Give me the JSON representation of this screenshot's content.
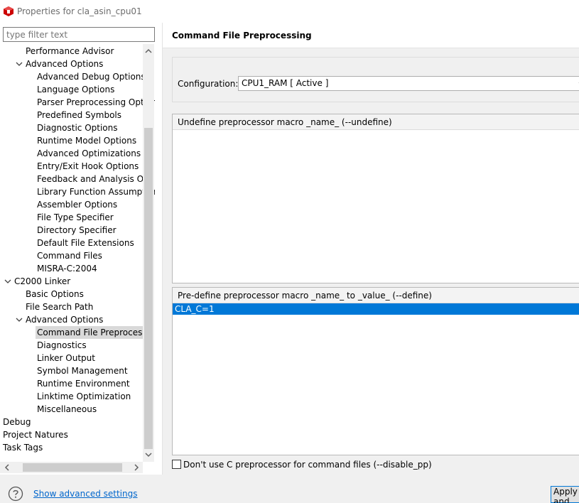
{
  "window": {
    "title": "Properties for cla_asin_cpu01",
    "icon": "ti-logo-icon",
    "accent": "#cc0000"
  },
  "filter": {
    "placeholder": "type filter text"
  },
  "tree": {
    "items": [
      {
        "label": "Performance Advisor",
        "depth": 2,
        "arrow": "none",
        "selected": false
      },
      {
        "label": "Advanced Options",
        "depth": 1,
        "arrow": "expanded",
        "selected": false
      },
      {
        "label": "Advanced Debug Options",
        "depth": 3,
        "arrow": "none",
        "selected": false
      },
      {
        "label": "Language Options",
        "depth": 3,
        "arrow": "none",
        "selected": false
      },
      {
        "label": "Parser Preprocessing Options",
        "depth": 3,
        "arrow": "none",
        "selected": false
      },
      {
        "label": "Predefined Symbols",
        "depth": 3,
        "arrow": "none",
        "selected": false
      },
      {
        "label": "Diagnostic Options",
        "depth": 3,
        "arrow": "none",
        "selected": false
      },
      {
        "label": "Runtime Model Options",
        "depth": 3,
        "arrow": "none",
        "selected": false
      },
      {
        "label": "Advanced Optimizations",
        "depth": 3,
        "arrow": "none",
        "selected": false
      },
      {
        "label": "Entry/Exit Hook Options",
        "depth": 3,
        "arrow": "none",
        "selected": false
      },
      {
        "label": "Feedback and Analysis Options",
        "depth": 3,
        "arrow": "none",
        "selected": false
      },
      {
        "label": "Library Function Assumptions",
        "depth": 3,
        "arrow": "none",
        "selected": false
      },
      {
        "label": "Assembler Options",
        "depth": 3,
        "arrow": "none",
        "selected": false
      },
      {
        "label": "File Type Specifier",
        "depth": 3,
        "arrow": "none",
        "selected": false
      },
      {
        "label": "Directory Specifier",
        "depth": 3,
        "arrow": "none",
        "selected": false
      },
      {
        "label": "Default File Extensions",
        "depth": 3,
        "arrow": "none",
        "selected": false
      },
      {
        "label": "Command Files",
        "depth": 3,
        "arrow": "none",
        "selected": false
      },
      {
        "label": "MISRA-C:2004",
        "depth": 3,
        "arrow": "none",
        "selected": false
      },
      {
        "label": "C2000 Linker",
        "depth": 0,
        "arrow": "expanded",
        "selected": false
      },
      {
        "label": "Basic Options",
        "depth": 2,
        "arrow": "none",
        "selected": false
      },
      {
        "label": "File Search Path",
        "depth": 2,
        "arrow": "none",
        "selected": false
      },
      {
        "label": "Advanced Options",
        "depth": 1,
        "arrow": "expanded",
        "selected": false
      },
      {
        "label": "Command File Preprocessing",
        "depth": 3,
        "arrow": "none",
        "selected": true
      },
      {
        "label": "Diagnostics",
        "depth": 3,
        "arrow": "none",
        "selected": false
      },
      {
        "label": "Linker Output",
        "depth": 3,
        "arrow": "none",
        "selected": false
      },
      {
        "label": "Symbol Management",
        "depth": 3,
        "arrow": "none",
        "selected": false
      },
      {
        "label": "Runtime Environment",
        "depth": 3,
        "arrow": "none",
        "selected": false
      },
      {
        "label": "Linktime Optimization",
        "depth": 3,
        "arrow": "none",
        "selected": false
      },
      {
        "label": "Miscellaneous",
        "depth": 3,
        "arrow": "none",
        "selected": false
      },
      {
        "label": "Debug",
        "depth": -1,
        "arrow": "none",
        "selected": false
      },
      {
        "label": "Project Natures",
        "depth": -1,
        "arrow": "none",
        "selected": false
      },
      {
        "label": "Task Tags",
        "depth": -1,
        "arrow": "none",
        "selected": false
      }
    ]
  },
  "page": {
    "title": "Command File Preprocessing"
  },
  "configuration": {
    "label": "Configuration:",
    "value": "CPU1_RAM  [ Active ]"
  },
  "undefine_list": {
    "header": "Undefine preprocessor macro _name_ (--undefine)",
    "rows": []
  },
  "define_list": {
    "header": "Pre-define preprocessor macro _name_ to _value_ (--define)",
    "rows": [
      "CLA_C=1"
    ]
  },
  "disable_pp": {
    "label": "Don't use C preprocessor for command files (--disable_pp)",
    "checked": false
  },
  "footer": {
    "advanced_link": "Show advanced settings",
    "apply_label": "Apply and Close"
  },
  "colors": {
    "selection": "#0078d7",
    "tree_selection": "#d9d9d9",
    "link": "#0066cc",
    "panel_bg": "#f0f0f0"
  }
}
